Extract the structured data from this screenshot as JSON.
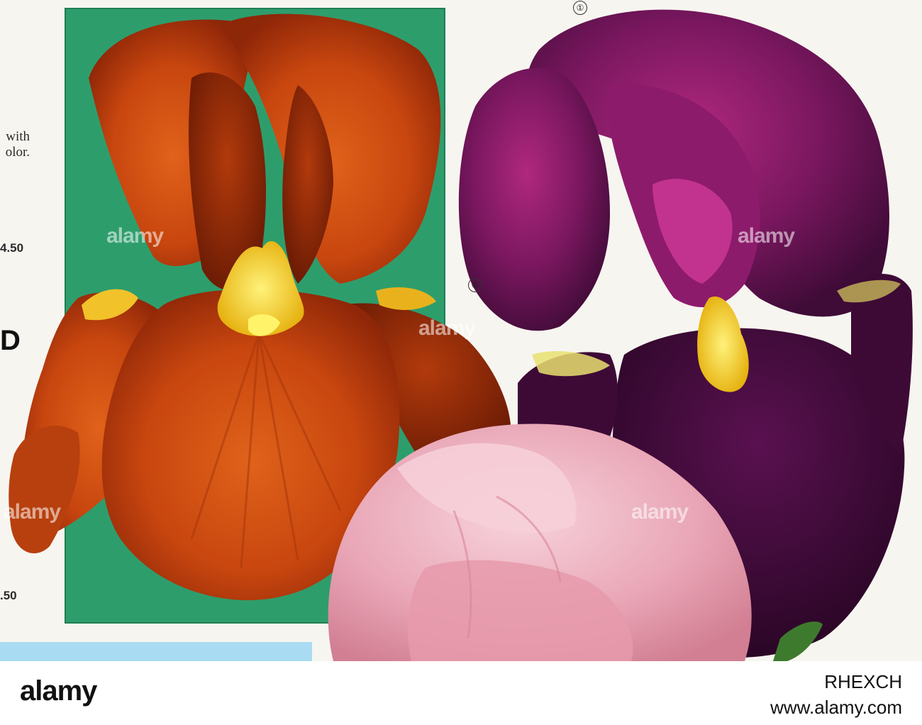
{
  "page_fragments": {
    "text_lines": [
      "with",
      "olor."
    ],
    "price_1": "4.50",
    "letter": "D",
    "price_2": ".50"
  },
  "markers": {
    "circle_1": "①",
    "circle_5": "⑤"
  },
  "watermark": "alamy",
  "footer": {
    "image_id": "RHEXCH",
    "site": "www.alamy.com"
  },
  "colors": {
    "green_background": "#2e9d6c",
    "orange_iris": "#c8460f",
    "purple_iris": "#6b1456",
    "pink_iris": "#e9a6b6",
    "blue_panel": "#a9dcf2"
  }
}
